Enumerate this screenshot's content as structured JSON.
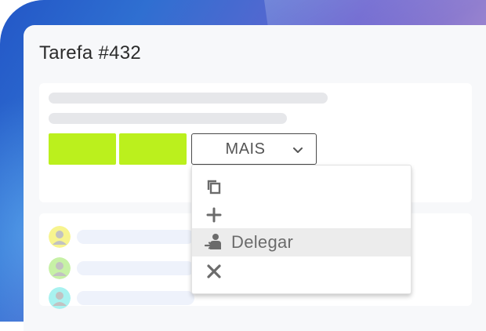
{
  "task": {
    "title": "Tarefa #432"
  },
  "actions": {
    "more_label": "MAIS",
    "menu_items": [
      {
        "icon": "copy-icon",
        "label": ""
      },
      {
        "icon": "plus-icon",
        "label": ""
      },
      {
        "icon": "delegate-icon",
        "label": "Delegar"
      },
      {
        "icon": "close-icon",
        "label": ""
      }
    ],
    "highlighted_index": 2
  },
  "colors": {
    "accent_green": "#bbf01d",
    "avatar_1_bg": "#f7f48f",
    "avatar_2_bg": "#c7f1a6",
    "avatar_3_bg": "#a8f2f0",
    "menu_text": "#6b6b6b"
  },
  "assignees": [
    {
      "avatar_color": "#f7f48f"
    },
    {
      "avatar_color": "#c7f1a6"
    },
    {
      "avatar_color": "#a8f2f0"
    }
  ]
}
